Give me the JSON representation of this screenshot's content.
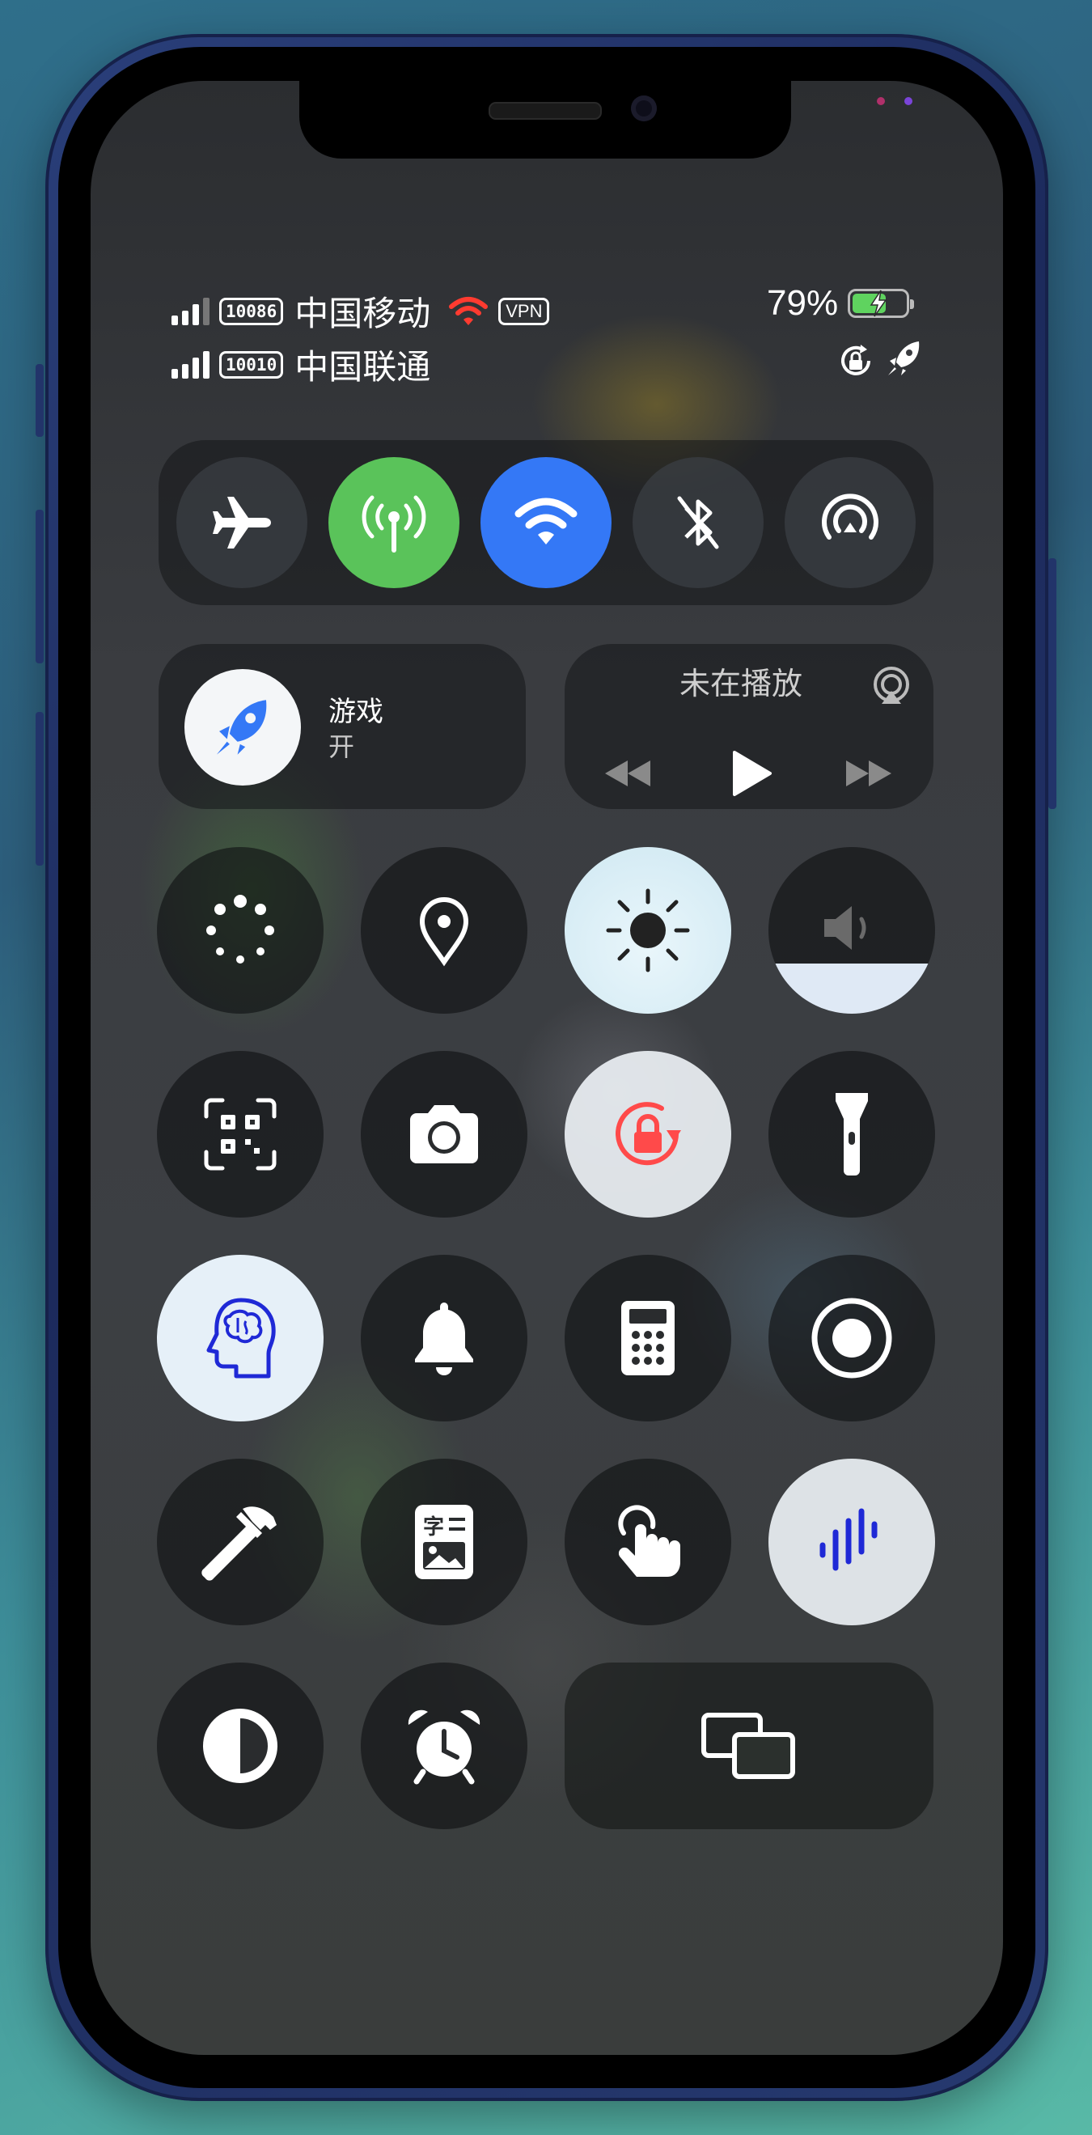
{
  "status_bar": {
    "sim1": {
      "number": "10086",
      "carrier": "中国移动",
      "vpn": "VPN"
    },
    "sim2": {
      "number": "10010",
      "carrier": "中国联通"
    },
    "battery_percent": "79%",
    "battery_level": 0.79,
    "icons": [
      "signal-bars-icon",
      "wifi-icon",
      "battery-charging-icon",
      "rotation-lock-icon",
      "rocket-icon"
    ]
  },
  "connectivity": [
    {
      "name": "airplane-mode",
      "icon": "airplane-icon",
      "state": "off"
    },
    {
      "name": "cellular-data",
      "icon": "antenna-icon",
      "state": "on",
      "color": "#5ac35a"
    },
    {
      "name": "wifi",
      "icon": "wifi-icon",
      "state": "on",
      "color": "#3478f6"
    },
    {
      "name": "bluetooth",
      "icon": "bluetooth-off-icon",
      "state": "off"
    },
    {
      "name": "airdrop",
      "icon": "airdrop-icon",
      "state": "off"
    }
  ],
  "focus": {
    "title": "游戏",
    "status": "开",
    "icon": "rocket-icon"
  },
  "now_playing": {
    "title": "未在播放",
    "icons": [
      "airplay-icon",
      "previous-icon",
      "play-icon",
      "next-icon"
    ]
  },
  "controls": {
    "row1": [
      "loading-icon",
      "location-icon",
      "brightness-icon",
      "volume-icon"
    ],
    "row2": [
      "qr-scanner-icon",
      "camera-icon",
      "rotation-lock-icon",
      "flashlight-icon"
    ],
    "row3": [
      "brain-icon",
      "bell-icon",
      "calculator-icon",
      "screen-record-icon"
    ],
    "row4": [
      "hammer-icon",
      "text-recognition-icon",
      "touch-icon",
      "sound-recognition-icon"
    ],
    "row5": [
      "dark-mode-icon",
      "alarm-icon",
      "screen-mirroring-icon"
    ]
  },
  "brightness_level": 1.0,
  "volume_level": 0.3,
  "colors": {
    "accent_red": "#ff3b30",
    "green": "#5ac35a",
    "blue": "#3478f6",
    "sound_blue": "#1f29d6"
  }
}
